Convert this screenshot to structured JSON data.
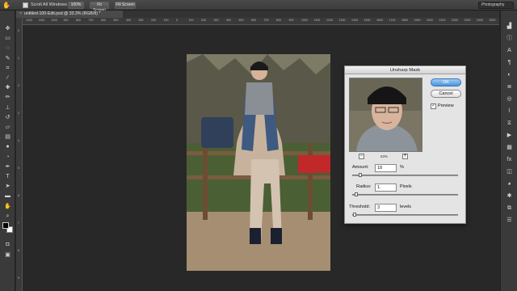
{
  "options_bar": {
    "scroll_all_windows": "Scroll All Windows",
    "btn_100": "100%",
    "btn_fit": "Fit Screen",
    "btn_fill": "Fill Screen",
    "workspace": "Photography"
  },
  "document": {
    "tab_label": "untitled-100-Edit.psd @ 33.3% (RGB/8) *",
    "close_glyph": "×"
  },
  "rulers": {
    "h_ticks": [
      "1200",
      "1100",
      "1000",
      "900",
      "800",
      "700",
      "600",
      "500",
      "400",
      "300",
      "200",
      "100",
      "0",
      "100",
      "200",
      "300",
      "400",
      "500",
      "600",
      "700",
      "800",
      "900",
      "1000",
      "1100",
      "1200",
      "1300",
      "1400",
      "1500",
      "1600",
      "1700",
      "1800",
      "1900",
      "2000",
      "2100",
      "2200",
      "2300",
      "2400",
      "2500"
    ],
    "v_ticks": [
      "0",
      "1",
      "2",
      "3",
      "4",
      "5",
      "6",
      "7",
      "8",
      "9"
    ]
  },
  "dialog": {
    "title": "Unsharp Mask",
    "ok": "OK",
    "cancel": "Cancel",
    "preview_label": "Preview",
    "preview_checked": true,
    "zoom_level": "63%",
    "zoom_out": "−",
    "zoom_in": "+",
    "amount_label": "Amount:",
    "amount_value": "18",
    "amount_unit": "%",
    "amount_level": 0.06,
    "radius_label": "Radius:",
    "radius_value": "1.",
    "radius_unit": "Pixels",
    "radius_level": 0.02,
    "threshold_label": "Threshold:",
    "threshold_value": "3",
    "threshold_unit": "levels",
    "threshold_level": 0.01
  },
  "tools_left": [
    "move-icon",
    "marquee-icon",
    "lasso-icon",
    "quick-select-icon",
    "crop-icon",
    "eyedropper-icon",
    "healing-icon",
    "brush-icon",
    "clone-stamp-icon",
    "history-brush-icon",
    "eraser-icon",
    "gradient-icon",
    "blur-icon",
    "dodge-icon",
    "pen-icon",
    "type-icon",
    "path-select-icon",
    "shape-icon",
    "hand-icon",
    "zoom-icon"
  ],
  "dock_right": [
    "histogram-icon",
    "info-icon",
    "character-icon",
    "paragraph-icon",
    "adjustments-icon",
    "layers-icon",
    "channels-icon",
    "paths-icon",
    "history-icon",
    "actions-icon",
    "swatches-icon",
    "styles-icon",
    "navigator-icon",
    "color-icon",
    "brush-presets-icon",
    "clone-source-icon",
    "properties-icon"
  ]
}
